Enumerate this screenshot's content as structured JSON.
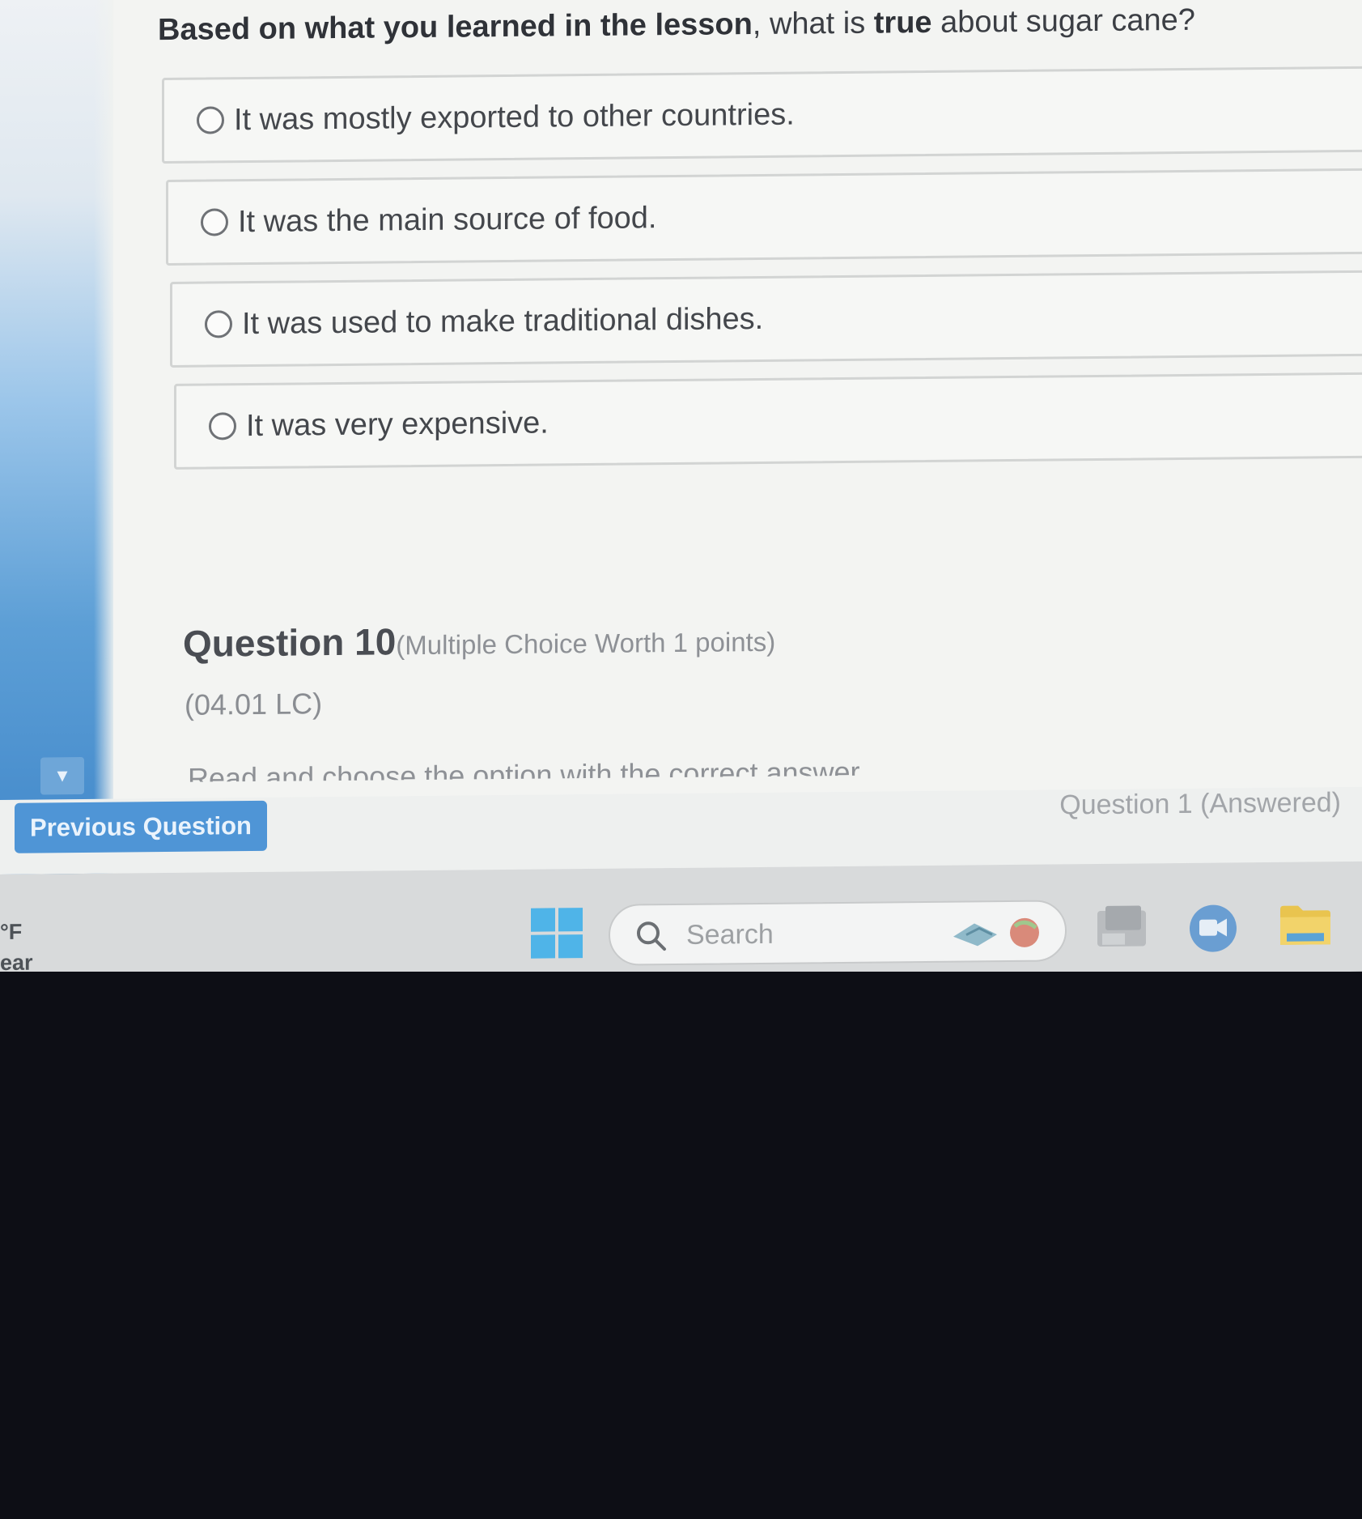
{
  "question": {
    "text_bold": "Based on what you learned in the lesson",
    "text_mid": ", what is ",
    "text_bold2": "true",
    "text_end": " about sugar cane?"
  },
  "options": [
    {
      "label": "It was mostly exported to other countries."
    },
    {
      "label": "It was the main source of food."
    },
    {
      "label": "It was used to make traditional dishes."
    },
    {
      "label": "It was very expensive."
    }
  ],
  "next_question": {
    "title": "Question 10",
    "meta": "(Multiple Choice Worth 1 points)",
    "code": "(04.01 LC)",
    "instruction": "Read and choose the option with the correct answer"
  },
  "navigation": {
    "previous_label": "Previous Question",
    "status_label": "Question 1 (Answered)"
  },
  "taskbar": {
    "weather_line1": "°F",
    "weather_line2": "ear",
    "search_placeholder": "Search"
  },
  "colors": {
    "accent": "#4f95d6",
    "windows_logo": "#4fb4e8"
  }
}
